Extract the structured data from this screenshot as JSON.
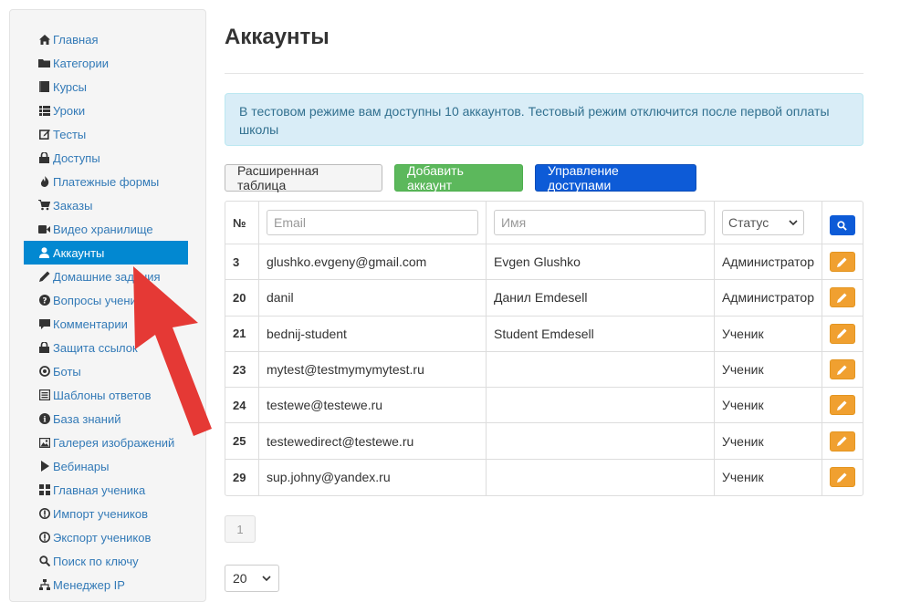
{
  "sidebar": {
    "items": [
      {
        "label": "Главная",
        "icon": "home-icon"
      },
      {
        "label": "Категории",
        "icon": "folder-icon"
      },
      {
        "label": "Курсы",
        "icon": "book-icon"
      },
      {
        "label": "Уроки",
        "icon": "list-icon"
      },
      {
        "label": "Тесты",
        "icon": "edit-icon"
      },
      {
        "label": "Доступы",
        "icon": "lock-icon"
      },
      {
        "label": "Платежные формы",
        "icon": "fire-icon"
      },
      {
        "label": "Заказы",
        "icon": "cart-icon"
      },
      {
        "label": "Видео хранилище",
        "icon": "video-icon"
      },
      {
        "label": "Аккаунты",
        "icon": "user-icon",
        "active": true
      },
      {
        "label": "Домашние задания",
        "icon": "pencil-icon"
      },
      {
        "label": "Вопросы учеников",
        "icon": "question-icon"
      },
      {
        "label": "Комментарии",
        "icon": "comment-icon"
      },
      {
        "label": "Защита ссылок",
        "icon": "lock-icon"
      },
      {
        "label": "Боты",
        "icon": "record-icon"
      },
      {
        "label": "Шаблоны ответов",
        "icon": "list-alt-icon"
      },
      {
        "label": "База знаний",
        "icon": "info-icon"
      },
      {
        "label": "Галерея изображений",
        "icon": "picture-icon"
      },
      {
        "label": "Вебинары",
        "icon": "play-icon"
      },
      {
        "label": "Главная ученика",
        "icon": "grid-icon"
      },
      {
        "label": "Импорт учеников",
        "icon": "import-icon"
      },
      {
        "label": "Экспорт учеников",
        "icon": "export-icon"
      },
      {
        "label": "Поиск по ключу",
        "icon": "search-icon"
      },
      {
        "label": "Менеджер IP",
        "icon": "network-icon"
      }
    ]
  },
  "main": {
    "title": "Аккаунты",
    "alert": "В тестовом режиме вам доступны 10 аккаунтов. Тестовый режим отключится после первой оплаты школы",
    "buttons": {
      "extended_table": "Расширенная таблица",
      "add_account": "Добавить аккаунт",
      "manage_access": "Управление доступами"
    }
  },
  "table": {
    "num_header": "№",
    "email_placeholder": "Email",
    "name_placeholder": "Имя",
    "status_select": "Статус",
    "rows": [
      {
        "id": "3",
        "email": "glushko.evgeny@gmail.com",
        "name": "Evgen Glushko",
        "status": "Администратор"
      },
      {
        "id": "20",
        "email": "danil",
        "name": "Данил Emdesell",
        "status": "Администратор"
      },
      {
        "id": "21",
        "email": "bednij-student",
        "name": "Student Emdesell",
        "status": "Ученик"
      },
      {
        "id": "23",
        "email": "mytest@testmymymytest.ru",
        "name": "",
        "status": "Ученик"
      },
      {
        "id": "24",
        "email": "testewe@testewe.ru",
        "name": "",
        "status": "Ученик"
      },
      {
        "id": "25",
        "email": "testewedirect@testewe.ru",
        "name": "",
        "status": "Ученик"
      },
      {
        "id": "29",
        "email": "sup.johny@yandex.ru",
        "name": "",
        "status": "Ученик"
      }
    ]
  },
  "pagination": {
    "page": "1"
  },
  "per_page": {
    "value": "20"
  },
  "colors": {
    "active": "#0288d1",
    "link": "#337ab7",
    "success": "#5cb85c",
    "primary": "#0d5bd7",
    "edit": "#f0a030",
    "arrow": "#e53935"
  }
}
